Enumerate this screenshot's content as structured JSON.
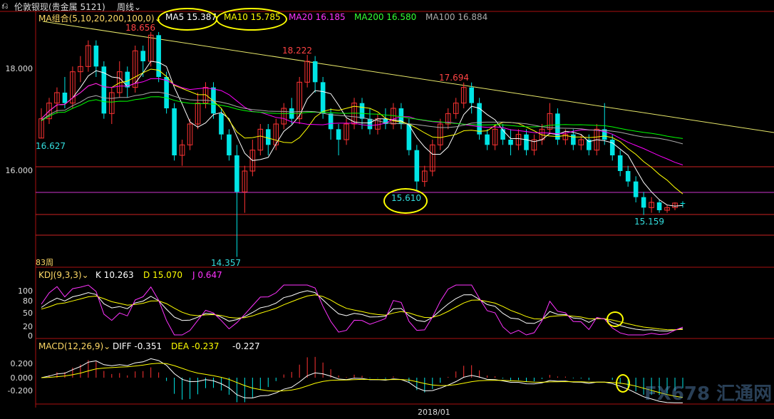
{
  "header": {
    "back_icon": "back-arrow-icon",
    "instrument": "伦敦银现(贵金属 5121)",
    "period": "周线",
    "dropdown_icon": "chevron-down-icon"
  },
  "price_panel": {
    "ma_label": "MA组合(5,10,20,200,100,0)",
    "ma5": "MA5 15.387",
    "ma10": "MA10 15.785",
    "ma20": "MA20 16.185",
    "ma200": "MA200 16.580",
    "ma100": "MA100 16.884",
    "colors": {
      "ma5": "#ffffff",
      "ma10": "#ffff00",
      "ma20": "#ff00ff",
      "ma200": "#00ff00",
      "ma100": "#aaaaaa",
      "up": "#ff3333",
      "down": "#00e5e5"
    },
    "y_ticks": [
      "18.000",
      "16.000"
    ],
    "annotations": {
      "high1": "18.656",
      "high2": "18.222",
      "high3": "17.694",
      "low_left": "16.627",
      "low_mid": "15.610",
      "low_right": "15.159",
      "low_min": "14.357"
    },
    "weeks_label": "83周"
  },
  "kdj_panel": {
    "label": "KDJ(9,3,3)",
    "k": "K 10.263",
    "d": "D 15.070",
    "j": "J 0.647",
    "y_ticks": [
      "100",
      "80",
      "50",
      "20",
      "0"
    ]
  },
  "macd_panel": {
    "label": "MACD(12,26,9)",
    "diff": "DIFF -0.351",
    "dea": "DEA -0.237",
    "macd": "-0.227",
    "y_ticks": [
      "0.200",
      "0.000",
      "-0.200"
    ]
  },
  "x_axis": {
    "date_label": "2018/01"
  },
  "watermark": "FX678 汇通网",
  "chart_data": {
    "type": "candlestick",
    "ylim": [
      14.2,
      19.0
    ],
    "candles": [
      [
        16.63,
        17.0,
        16.63,
        17.2
      ],
      [
        17.0,
        17.3,
        16.9,
        17.4
      ],
      [
        17.3,
        17.5,
        17.1,
        17.6
      ],
      [
        17.5,
        17.3,
        17.2,
        17.8
      ],
      [
        17.3,
        17.9,
        17.2,
        18.0
      ],
      [
        17.9,
        18.0,
        17.7,
        18.2
      ],
      [
        18.0,
        18.4,
        17.9,
        18.5
      ],
      [
        18.4,
        18.0,
        17.8,
        18.5
      ],
      [
        18.0,
        17.1,
        17.0,
        18.1
      ],
      [
        17.1,
        17.5,
        16.9,
        17.6
      ],
      [
        17.5,
        17.9,
        17.4,
        18.1
      ],
      [
        17.9,
        17.6,
        17.4,
        18.0
      ],
      [
        17.6,
        18.3,
        17.5,
        18.4
      ],
      [
        18.3,
        18.1,
        17.8,
        18.4
      ],
      [
        18.1,
        18.6,
        18.0,
        18.66
      ],
      [
        18.6,
        17.8,
        17.7,
        18.66
      ],
      [
        17.8,
        17.2,
        17.1,
        17.9
      ],
      [
        17.2,
        16.3,
        16.2,
        17.3
      ],
      [
        16.3,
        16.5,
        16.1,
        16.6
      ],
      [
        16.5,
        16.9,
        16.4,
        17.0
      ],
      [
        16.9,
        17.3,
        16.8,
        17.5
      ],
      [
        17.3,
        17.6,
        17.2,
        17.7
      ],
      [
        17.6,
        17.1,
        17.0,
        17.7
      ],
      [
        17.1,
        16.7,
        16.6,
        17.2
      ],
      [
        16.7,
        16.3,
        16.2,
        16.8
      ],
      [
        16.3,
        15.6,
        14.357,
        16.5
      ],
      [
        15.6,
        16.0,
        15.2,
        16.1
      ],
      [
        16.0,
        16.4,
        15.9,
        16.6
      ],
      [
        16.4,
        16.8,
        16.3,
        16.9
      ],
      [
        16.8,
        16.5,
        16.3,
        16.9
      ],
      [
        16.5,
        16.9,
        16.4,
        17.0
      ],
      [
        16.9,
        17.2,
        16.8,
        17.3
      ],
      [
        17.2,
        17.0,
        16.9,
        17.4
      ],
      [
        17.0,
        17.7,
        16.9,
        17.8
      ],
      [
        17.7,
        18.1,
        17.6,
        18.222
      ],
      [
        18.1,
        17.7,
        17.5,
        18.2
      ],
      [
        17.7,
        17.1,
        17.0,
        17.8
      ],
      [
        17.1,
        16.8,
        16.6,
        17.2
      ],
      [
        16.8,
        16.6,
        16.3,
        16.9
      ],
      [
        16.6,
        16.9,
        16.5,
        17.0
      ],
      [
        16.9,
        17.3,
        16.8,
        17.4
      ],
      [
        17.3,
        17.0,
        16.8,
        17.4
      ],
      [
        17.0,
        16.8,
        16.7,
        17.2
      ],
      [
        16.8,
        17.0,
        16.7,
        17.1
      ],
      [
        17.0,
        16.9,
        16.8,
        17.2
      ],
      [
        16.9,
        17.2,
        16.8,
        17.3
      ],
      [
        17.2,
        16.9,
        16.8,
        17.3
      ],
      [
        16.9,
        16.4,
        16.3,
        17.0
      ],
      [
        16.4,
        15.8,
        15.61,
        16.5
      ],
      [
        15.8,
        16.0,
        15.7,
        16.1
      ],
      [
        16.0,
        16.5,
        15.9,
        16.6
      ],
      [
        16.5,
        16.9,
        16.4,
        17.0
      ],
      [
        16.9,
        17.1,
        16.8,
        17.2
      ],
      [
        17.1,
        17.3,
        17.0,
        17.4
      ],
      [
        17.3,
        17.6,
        17.2,
        17.694
      ],
      [
        17.6,
        17.3,
        17.1,
        17.694
      ],
      [
        17.3,
        16.7,
        16.6,
        17.4
      ],
      [
        16.7,
        16.5,
        16.4,
        16.8
      ],
      [
        16.5,
        16.8,
        16.4,
        16.9
      ],
      [
        16.8,
        16.6,
        16.5,
        16.9
      ],
      [
        16.6,
        16.5,
        16.3,
        16.8
      ],
      [
        16.5,
        16.7,
        16.4,
        16.8
      ],
      [
        16.7,
        16.4,
        16.3,
        16.8
      ],
      [
        16.4,
        16.6,
        16.3,
        16.7
      ],
      [
        16.6,
        16.8,
        16.5,
        16.9
      ],
      [
        16.8,
        17.1,
        16.7,
        17.3
      ],
      [
        17.1,
        16.6,
        16.5,
        17.2
      ],
      [
        16.6,
        16.7,
        16.5,
        16.8
      ],
      [
        16.7,
        16.5,
        16.4,
        16.8
      ],
      [
        16.5,
        16.6,
        16.4,
        16.7
      ],
      [
        16.6,
        16.4,
        16.3,
        16.7
      ],
      [
        16.4,
        16.8,
        16.3,
        16.9
      ],
      [
        16.8,
        16.6,
        16.5,
        17.3
      ],
      [
        16.6,
        16.3,
        16.2,
        16.7
      ],
      [
        16.3,
        16.0,
        15.9,
        16.4
      ],
      [
        16.0,
        15.8,
        15.7,
        16.1
      ],
      [
        15.8,
        15.5,
        15.4,
        15.9
      ],
      [
        15.5,
        15.3,
        15.159,
        15.6
      ],
      [
        15.3,
        15.4,
        15.2,
        15.5
      ],
      [
        15.4,
        15.25,
        15.2,
        15.45
      ],
      [
        15.25,
        15.3,
        15.2,
        15.35
      ],
      [
        15.3,
        15.387,
        15.25,
        15.4
      ],
      [
        15.387,
        15.38,
        15.3,
        15.42
      ]
    ]
  }
}
